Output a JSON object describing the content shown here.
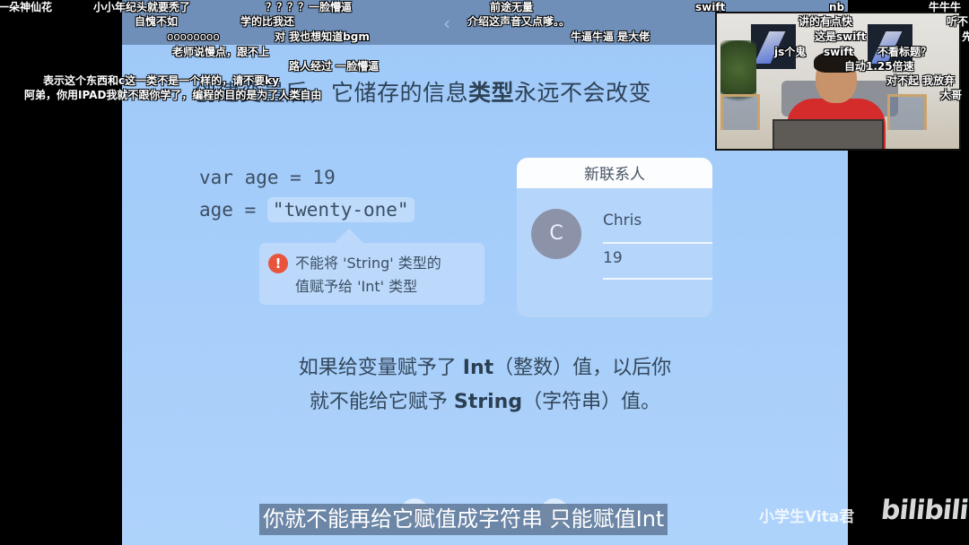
{
  "slide": {
    "nav_back_icon": "chevron-left-icon",
    "heading_prefix": "创建变量后，它储存的信息",
    "heading_strong": "类型",
    "heading_suffix": "永远不会改变",
    "code": {
      "line1": "var age = 19",
      "line2_prefix": "age = ",
      "line2_literal": "\"twenty-one\""
    },
    "error": {
      "icon": "exclamation-icon",
      "line1": "不能将 'String' 类型的",
      "line2": "值赋予给 'Int' 类型"
    },
    "contact_card": {
      "title": "新联系人",
      "avatar_initial": "C",
      "name_value": "Chris",
      "age_value": "19"
    },
    "body": {
      "l1_a": "如果给变量赋予了 ",
      "l1_b": "Int",
      "l1_c": "（整数）值，以后你",
      "l2_a": "就不能给它赋予 ",
      "l2_b": "String",
      "l2_c": "（字符串）值。"
    },
    "prev_icon": "chevron-left-icon",
    "next_icon": "chevron-right-icon"
  },
  "subtitle": "你就不能再给它赋值成字符串 只能赋值Int",
  "watermark": "小学生Vita君",
  "logo": "bilibili",
  "danmaku": [
    "一朵神仙花",
    "小小年纪头就要秃了",
    "？？？？一脸懵逼",
    "前途无量",
    "swift",
    "nb",
    "牛牛牛",
    "自愧不如",
    "学的比我还",
    "介绍这声音又点嗲。。",
    "讲的有点快",
    "听不",
    "oooooooo",
    "对 我也想知道bgm",
    "牛逼牛逼 是大佬",
    "这是swift",
    "先",
    "老师说慢点，跟不上",
    "js个鬼",
    "swift",
    "不看标题？",
    "路人经过 一脸懵逼",
    "自动1.25倍速",
    "表示这个东西和c这一类不是一个样的，请不要ky",
    "对不起 我放弃",
    "阿弟，你用IPAD我就不跟你学了，编程的目的是为了人类自由",
    "大哥"
  ]
}
